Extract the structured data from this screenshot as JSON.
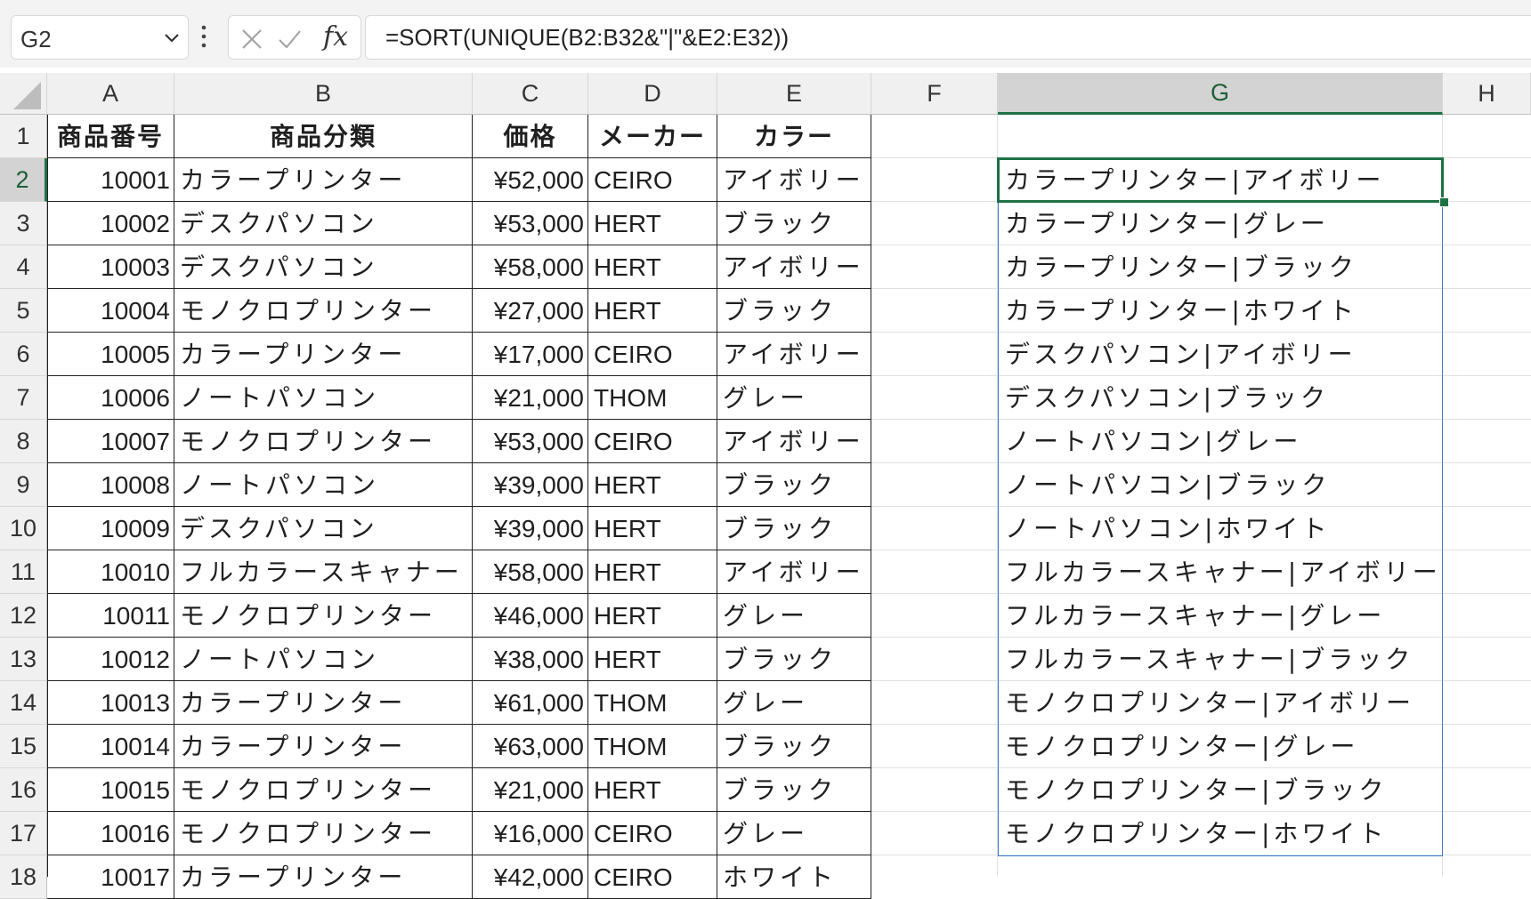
{
  "formula_bar": {
    "name_box": "G2",
    "fx_label": "fx",
    "formula": "=SORT(UNIQUE(B2:B32&\"|\"&E2:E32))"
  },
  "columns": [
    "A",
    "B",
    "C",
    "D",
    "E",
    "F",
    "G",
    "H"
  ],
  "selected_column": "G",
  "rows": [
    "1",
    "2",
    "3",
    "4",
    "5",
    "6",
    "7",
    "8",
    "9",
    "10",
    "11",
    "12",
    "13",
    "14",
    "15",
    "16",
    "17",
    "18"
  ],
  "selected_row": "2",
  "table_header": [
    "商品番号",
    "商品分類",
    "価格",
    "メーカー",
    "カラー"
  ],
  "table_rows": [
    [
      "10001",
      "カラープリンター",
      "¥52,000",
      "CEIRO",
      "アイボリー"
    ],
    [
      "10002",
      "デスクパソコン",
      "¥53,000",
      "HERT",
      "ブラック"
    ],
    [
      "10003",
      "デスクパソコン",
      "¥58,000",
      "HERT",
      "アイボリー"
    ],
    [
      "10004",
      "モノクロプリンター",
      "¥27,000",
      "HERT",
      "ブラック"
    ],
    [
      "10005",
      "カラープリンター",
      "¥17,000",
      "CEIRO",
      "アイボリー"
    ],
    [
      "10006",
      "ノートパソコン",
      "¥21,000",
      "THOM",
      "グレー"
    ],
    [
      "10007",
      "モノクロプリンター",
      "¥53,000",
      "CEIRO",
      "アイボリー"
    ],
    [
      "10008",
      "ノートパソコン",
      "¥39,000",
      "HERT",
      "ブラック"
    ],
    [
      "10009",
      "デスクパソコン",
      "¥39,000",
      "HERT",
      "ブラック"
    ],
    [
      "10010",
      "フルカラースキャナー",
      "¥58,000",
      "HERT",
      "アイボリー"
    ],
    [
      "10011",
      "モノクロプリンター",
      "¥46,000",
      "HERT",
      "グレー"
    ],
    [
      "10012",
      "ノートパソコン",
      "¥38,000",
      "HERT",
      "ブラック"
    ],
    [
      "10013",
      "カラープリンター",
      "¥61,000",
      "THOM",
      "グレー"
    ],
    [
      "10014",
      "カラープリンター",
      "¥63,000",
      "THOM",
      "ブラック"
    ],
    [
      "10015",
      "モノクロプリンター",
      "¥21,000",
      "HERT",
      "ブラック"
    ],
    [
      "10016",
      "モノクロプリンター",
      "¥16,000",
      "CEIRO",
      "グレー"
    ],
    [
      "10017",
      "カラープリンター",
      "¥42,000",
      "CEIRO",
      "ホワイト"
    ]
  ],
  "result_values": [
    "カラープリンター|アイボリー",
    "カラープリンター|グレー",
    "カラープリンター|ブラック",
    "カラープリンター|ホワイト",
    "デスクパソコン|アイボリー",
    "デスクパソコン|ブラック",
    "ノートパソコン|グレー",
    "ノートパソコン|ブラック",
    "ノートパソコン|ホワイト",
    "フルカラースキャナー|アイボリー",
    "フルカラースキャナー|グレー",
    "フルカラースキャナー|ブラック",
    "モノクロプリンター|アイボリー",
    "モノクロプリンター|グレー",
    "モノクロプリンター|ブラック",
    "モノクロプリンター|ホワイト"
  ],
  "colors": {
    "selection": "#1e7145",
    "spill_border": "#3a7bd5",
    "header_bg": "#f0f0f0"
  }
}
